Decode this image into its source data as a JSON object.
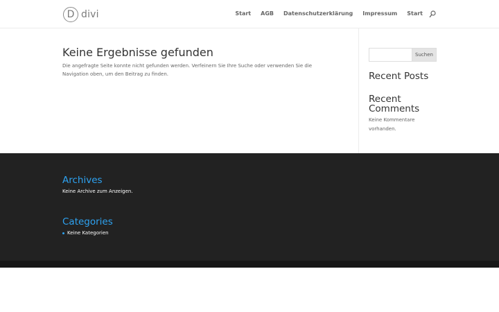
{
  "header": {
    "logo_letter": "D",
    "logo_text": "divi",
    "nav": [
      "Start",
      "AGB",
      "Datenschutzerklärung",
      "Impressum",
      "Start"
    ],
    "search_icon": "search-icon"
  },
  "main": {
    "title": "Keine Ergebnisse gefunden",
    "text": "Die angefragte Seite konnte nicht gefunden werden. Verfeinern Sie Ihre Suche oder verwenden Sie die Navigation oben, um den Beitrag zu finden."
  },
  "sidebar": {
    "search_placeholder": "",
    "search_button": "Suchen",
    "recent_posts_title": "Recent Posts",
    "recent_comments_title": "Recent Comments",
    "recent_comments_text": "Keine Kommentare vorhanden."
  },
  "footer": {
    "archives_title": "Archives",
    "archives_text": "Keine Archive zum Anzeigen.",
    "categories_title": "Categories",
    "categories_item": "Keine Kategorien"
  },
  "colors": {
    "accent": "#2ea3f2",
    "footer_bg": "#222222",
    "bottom_bar": "#171717"
  }
}
